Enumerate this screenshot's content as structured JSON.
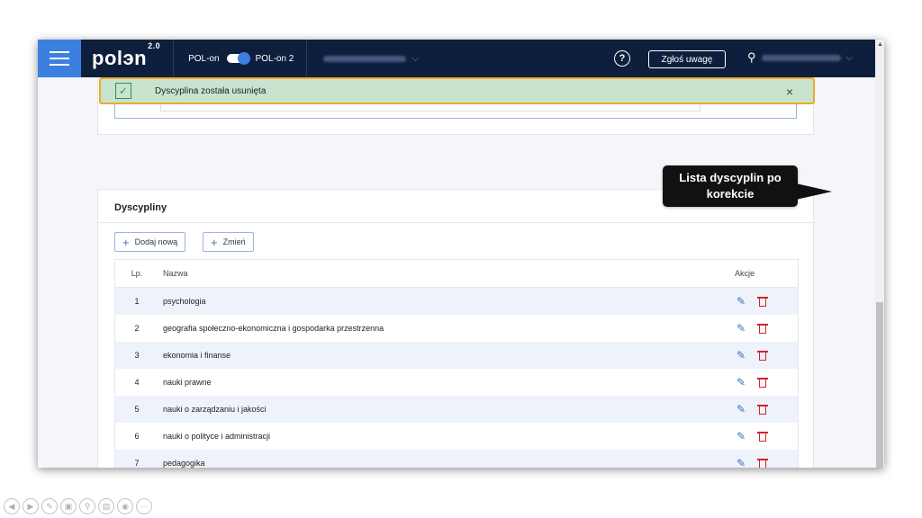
{
  "header": {
    "logo": "polэn",
    "logo_version": "2.0",
    "toggle_left": "POL-on",
    "toggle_right": "POL-on 2",
    "help": "?",
    "report_button": "Zgłoś uwagę"
  },
  "toast": {
    "message": "Dyscyplina została usunięta",
    "close": "×"
  },
  "section": {
    "title": "Dyscypliny",
    "add_button": "Dodaj nową",
    "change_button": "Zmień"
  },
  "table": {
    "headers": {
      "lp": "Lp.",
      "name": "Nazwa",
      "actions": "Akcje"
    },
    "rows": [
      {
        "lp": "1",
        "name": "psychologia"
      },
      {
        "lp": "2",
        "name": "geografia społeczno-ekonomiczna i gospodarka przestrzenna"
      },
      {
        "lp": "3",
        "name": "ekonomia i finanse"
      },
      {
        "lp": "4",
        "name": "nauki prawne"
      },
      {
        "lp": "5",
        "name": "nauki o zarządzaniu i jakości"
      },
      {
        "lp": "6",
        "name": "nauki o polityce i administracji"
      },
      {
        "lp": "7",
        "name": "pedagogika"
      }
    ]
  },
  "callout": {
    "line1": "Lista dyscyplin po",
    "line2": "korekcie"
  },
  "colors": {
    "topbar": "#0d1f3c",
    "accent": "#3d7fe0",
    "toast_bg": "#c8e4ce",
    "toast_border": "#f0a92a",
    "delete": "#d6202a"
  }
}
